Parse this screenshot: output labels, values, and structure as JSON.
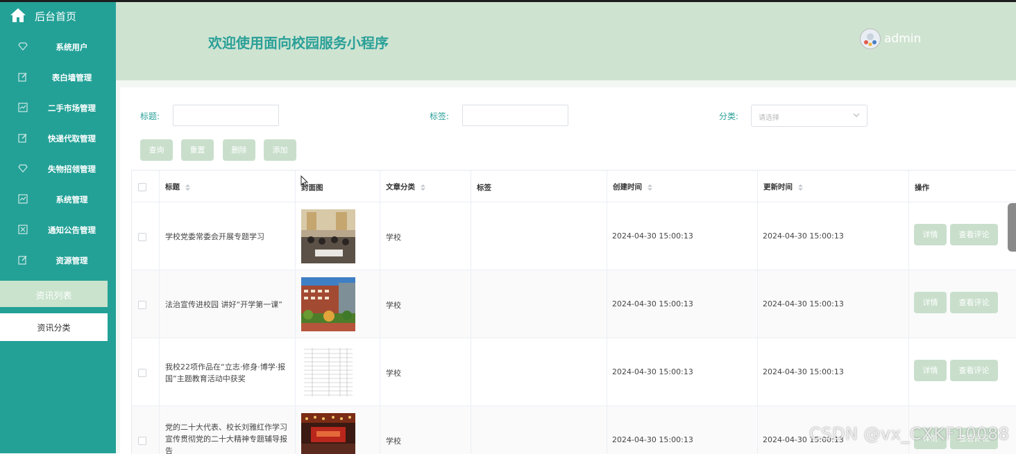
{
  "sidebar": {
    "home_label": "后台首页",
    "items": [
      {
        "label": "系统用户",
        "icon": "diamond-icon"
      },
      {
        "label": "表白墙管理",
        "icon": "edit-icon"
      },
      {
        "label": "二手市场管理",
        "icon": "chart-icon"
      },
      {
        "label": "快递代取管理",
        "icon": "edit-icon"
      },
      {
        "label": "失物招领管理",
        "icon": "diamond-icon"
      },
      {
        "label": "系统管理",
        "icon": "chart-icon"
      },
      {
        "label": "通知公告管理",
        "icon": "close-box-icon"
      },
      {
        "label": "资源管理",
        "icon": "edit-icon"
      }
    ],
    "sub_items": [
      {
        "label": "资讯列表",
        "active": true
      },
      {
        "label": "资讯分类",
        "active": false
      }
    ],
    "colors": {
      "bg": "#23a197",
      "active": "#c9e3cd"
    }
  },
  "header": {
    "title": "欢迎使用面向校园服务小程序",
    "user": "admin"
  },
  "filters": {
    "title_label": "标题:",
    "tag_label": "标签:",
    "category_label": "分类:",
    "category_placeholder": "请选择",
    "buttons": {
      "query": "查询",
      "reset": "重置",
      "delete": "删除",
      "add": "添加"
    }
  },
  "table": {
    "headers": {
      "title": "标题",
      "cover": "封面图",
      "category": "文章分类",
      "tag": "标签",
      "created": "创建时间",
      "updated": "更新时间",
      "actions": "操作"
    },
    "rows": [
      {
        "title": "学校党委常委会开展专题学习",
        "category": "学校",
        "tag": "",
        "created": "2024-04-30 15:00:13",
        "updated": "2024-04-30 15:00:13",
        "cover": "meeting-photo"
      },
      {
        "title": "法治宣传进校园 讲好“开学第一课”",
        "category": "学校",
        "tag": "",
        "created": "2024-04-30 15:00:13",
        "updated": "2024-04-30 15:00:13",
        "cover": "building-photo"
      },
      {
        "title": "我校22项作品在“立志·修身·博学·报国”主题教育活动中获奖",
        "category": "学校",
        "tag": "",
        "created": "2024-04-30 15:00:13",
        "updated": "2024-04-30 15:00:13",
        "cover": "document-photo"
      },
      {
        "title": "党的二十大代表、校长刘雅红作学习宣传贯彻党的二十大精神专题辅导报告",
        "category": "学校",
        "tag": "",
        "created": "2024-04-30 15:00:13",
        "updated": "2024-04-30 15:00:13",
        "cover": "stage-photo"
      }
    ],
    "row_actions": {
      "detail": "详情",
      "comments": "查看评论"
    }
  },
  "watermark": "CSDN @vx_CXKF10088"
}
